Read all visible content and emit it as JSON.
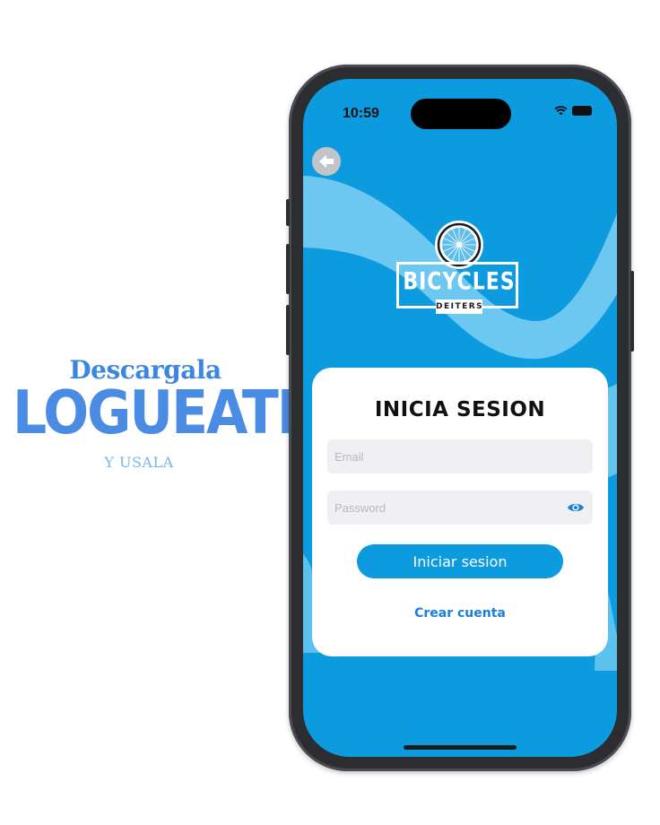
{
  "promo": {
    "line1": "Descargala",
    "line2": "LOGUEATE",
    "line3": "Y USALA"
  },
  "status_bar": {
    "time": "10:59",
    "signal_icon": "signal-dots-icon",
    "wifi_icon": "wifi-icon",
    "battery_icon": "battery-icon"
  },
  "nav": {
    "back_icon": "arrow-left-icon"
  },
  "logo": {
    "brand": "BICYCLES",
    "subtitle": "DEITERS"
  },
  "login": {
    "title": "INICIA SESION",
    "email_placeholder": "Email",
    "password_placeholder": "Password",
    "password_toggle_icon": "eye-icon",
    "submit_label": "Iniciar sesion",
    "create_account_label": "Crear cuenta"
  },
  "colors": {
    "primary": "#0d9be0",
    "wave": "#6cc8f0",
    "promo_blue": "#4a8be3",
    "link": "#1a7fdc"
  }
}
